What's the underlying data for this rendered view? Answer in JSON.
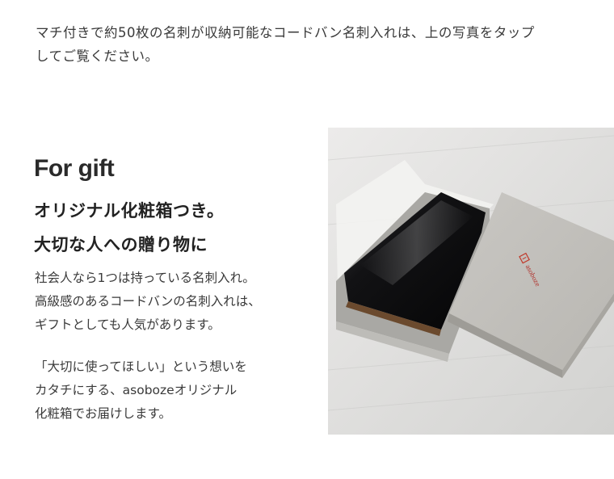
{
  "intro": {
    "line1": "マチ付きで約50枚の名刺が収納可能なコードバン名刺入れは、上の写真をタップ",
    "line2": "してご覧ください。"
  },
  "gift": {
    "heading": "For gift",
    "headline_line1": "オリジナル化粧箱つき。",
    "headline_line2": "大切な人への贈り物に",
    "body_lines_1": [
      "社会人なら1つは持っている名刺入れ。",
      "高級感のあるコードバンの名刺入れは、",
      "ギフトとしても人気があります。"
    ],
    "body_lines_2": [
      "「大切に使ってほしい」という想いを",
      "カタチにする、asobozeオリジナル",
      "化粧箱でお届けします。"
    ]
  },
  "photo": {
    "brand_on_lid": "asoboze",
    "logo_color": "#c0392b"
  }
}
